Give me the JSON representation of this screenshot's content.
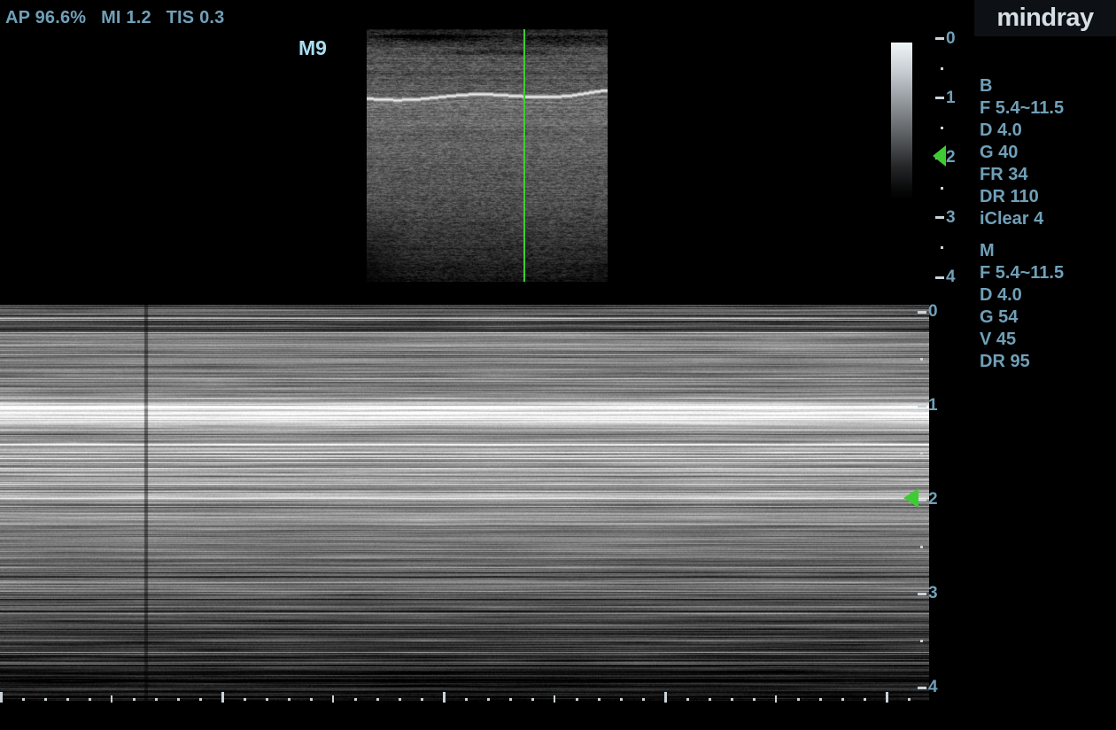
{
  "header": {
    "acoustic_power": "AP 96.6%",
    "mechanical_index": "MI 1.2",
    "thermal_index": "TIS 0.3",
    "probe": "M9",
    "brand": "mindray"
  },
  "b_params": {
    "header": "B",
    "lines": [
      "F 5.4~11.5",
      "D 4.0",
      "G 40",
      "FR 34",
      "DR 110",
      "iClear 4"
    ]
  },
  "m_params": {
    "header": "M",
    "lines": [
      "F 5.4~11.5",
      "D 4.0",
      "G 54",
      "V 45",
      "DR 95"
    ]
  },
  "b_depth_ruler": {
    "labels": [
      "0",
      "1",
      "2",
      "3",
      "4"
    ]
  },
  "m_depth_ruler": {
    "labels": [
      "0",
      "1",
      "2",
      "3",
      "4"
    ]
  },
  "colors": {
    "accent_text": "#70A0B8",
    "probe_label_text": "#A9DFF2",
    "tick": "#C9D3D9",
    "marker_green": "#3FCC33",
    "logo_text": "#D6DEE6"
  }
}
